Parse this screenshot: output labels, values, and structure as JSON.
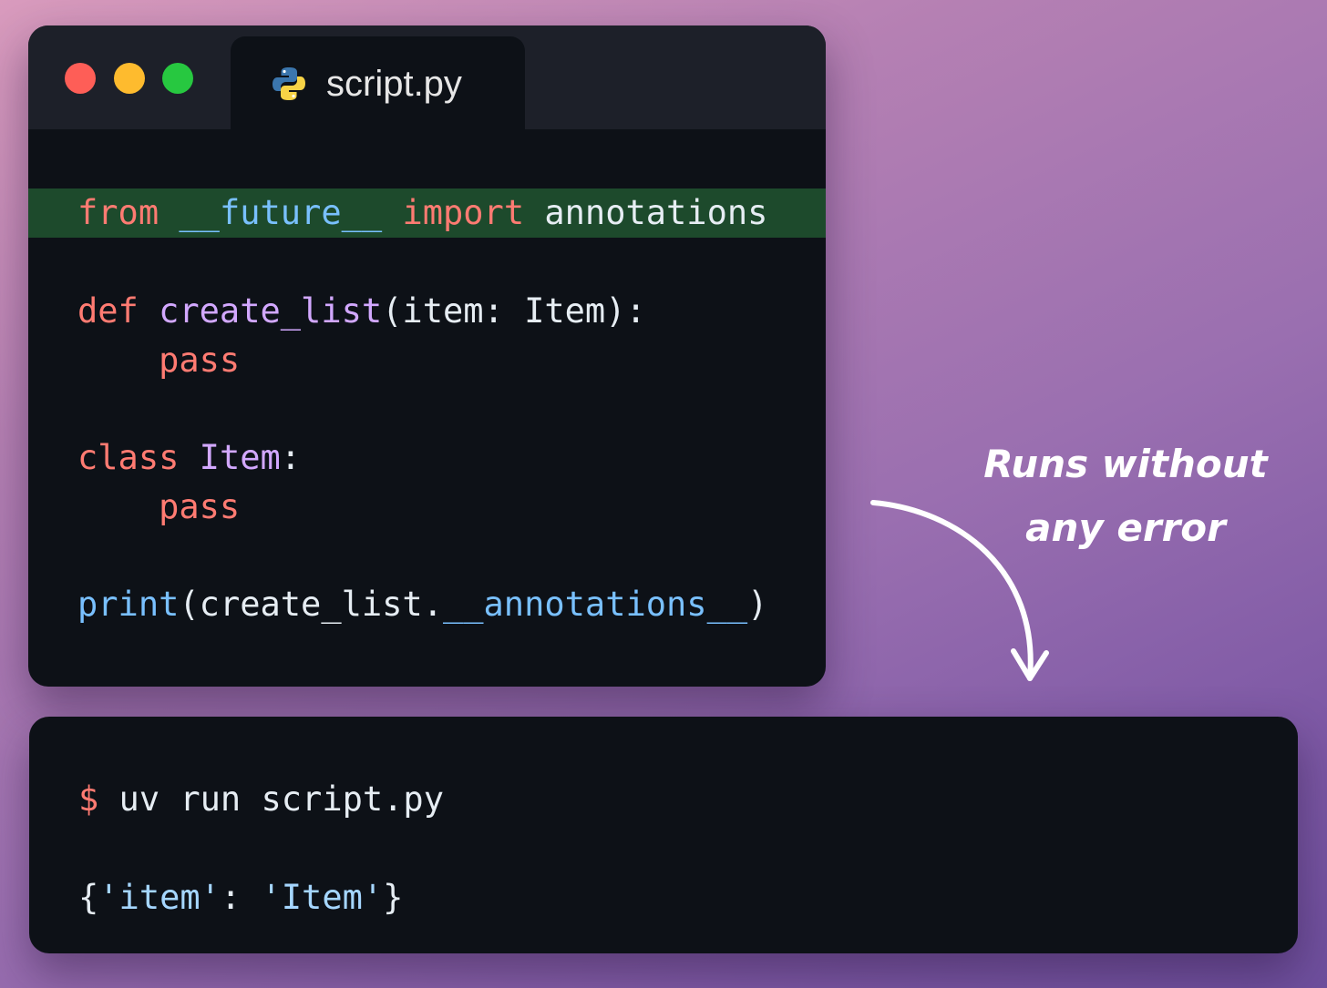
{
  "editor": {
    "window_controls": [
      "close",
      "minimize",
      "maximize"
    ],
    "tab": {
      "filename": "script.py",
      "icon": "python-logo-icon"
    },
    "highlight_color": "#1d4a2c",
    "lines": [
      {
        "tokens": [
          {
            "t": "from",
            "c": "kw"
          },
          {
            "t": " ",
            "c": "tx"
          },
          {
            "t": "__future__",
            "c": "bi"
          },
          {
            "t": " ",
            "c": "tx"
          },
          {
            "t": "import",
            "c": "kw"
          },
          {
            "t": " annotations",
            "c": "tx"
          }
        ],
        "highlighted": true
      },
      {
        "tokens": [
          {
            "t": "def",
            "c": "kw"
          },
          {
            "t": " ",
            "c": "tx"
          },
          {
            "t": "create_list",
            "c": "fn"
          },
          {
            "t": "(item: Item):",
            "c": "tx"
          }
        ]
      },
      {
        "tokens": [
          {
            "t": "    ",
            "c": "tx"
          },
          {
            "t": "pass",
            "c": "kw"
          }
        ]
      },
      {
        "tokens": [
          {
            "t": "class",
            "c": "kw"
          },
          {
            "t": " ",
            "c": "tx"
          },
          {
            "t": "Item",
            "c": "fn"
          },
          {
            "t": ":",
            "c": "tx"
          }
        ]
      },
      {
        "tokens": [
          {
            "t": "    ",
            "c": "tx"
          },
          {
            "t": "pass",
            "c": "kw"
          }
        ]
      },
      {
        "tokens": [
          {
            "t": "print",
            "c": "bi"
          },
          {
            "t": "(create_list.",
            "c": "tx"
          },
          {
            "t": "__annotations__",
            "c": "bi"
          },
          {
            "t": ")",
            "c": "tx"
          }
        ]
      }
    ]
  },
  "terminal": {
    "prompt": "$",
    "command": " uv run script.py",
    "output_tokens": [
      {
        "t": "{",
        "c": "tx"
      },
      {
        "t": "'item'",
        "c": "st"
      },
      {
        "t": ": ",
        "c": "tx"
      },
      {
        "t": "'Item'",
        "c": "st"
      },
      {
        "t": "}",
        "c": "tx"
      }
    ]
  },
  "annotation": {
    "line1": "Runs without",
    "line2": "any error"
  },
  "colors": {
    "keyword": "#ff7b72",
    "function": "#d2a8ff",
    "builtin": "#79c0ff",
    "string": "#a5d6ff",
    "text": "#e6edf3",
    "background": "#0d1117"
  }
}
